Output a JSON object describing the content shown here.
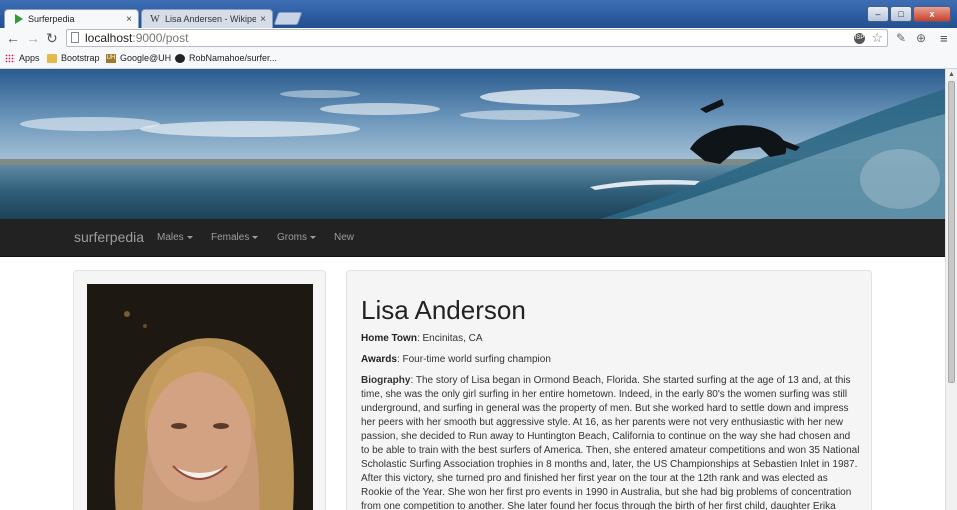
{
  "browser": {
    "tabs": [
      {
        "title": "Surferpedia",
        "close": "×",
        "active": true
      },
      {
        "title": "Lisa Andersen - Wikipedia",
        "close": "×",
        "active": false
      }
    ],
    "window_controls": {
      "minimize": "–",
      "maximize": "□",
      "close": "x"
    },
    "url_host": "localhost",
    "url_path": ":9000/post",
    "bookmarks": [
      "Apps",
      "Bootstrap",
      "Google@UH",
      "RobNamahoe/surfer..."
    ],
    "colors": {
      "titlebar": "#2c5aa0",
      "navbar": "#222222",
      "tab_active": "#f7f8fa"
    }
  },
  "navbar": {
    "brand": "surferpedia",
    "items": [
      {
        "label": "Males",
        "dropdown": true
      },
      {
        "label": "Females",
        "dropdown": true
      },
      {
        "label": "Groms",
        "dropdown": true
      },
      {
        "label": "New",
        "dropdown": false
      }
    ]
  },
  "surfer": {
    "name": "Lisa Anderson",
    "hometown_label": "Home Town",
    "hometown": ": Encinitas, CA",
    "awards_label": "Awards",
    "awards": ": Four-time world surfing champion",
    "biography_label": "Biography",
    "biography": ": The story of Lisa began in Ormond Beach, Florida. She started surfing at the age of 13 and, at this time, she was the only girl surfing in her entire hometown. Indeed, in the early 80's the women surfing was still underground, and surfing in general was the property of men. But she worked hard to settle down and impress her peers with her smooth but aggressive style. At 16, as her parents were not very enthusiastic with her new passion, she decided to Run away to Huntington Beach, California to continue on the way she had chosen and to be able to train with the best surfers of America. Then, she entered amateur competitions and won 35 National Scholastic Surfing Association trophies in 8 months and, later, the US Championships at Sebastien Inlet in 1987. After this victory, she turned pro and finished her first year on the tour at the 12th rank and was elected as Rookie of the Year. She won her first pro events in 1990 in Australia, but she had big problems of concentration from one competition to another. She later found her focus through the birth of her first child, daughter Erika"
  }
}
